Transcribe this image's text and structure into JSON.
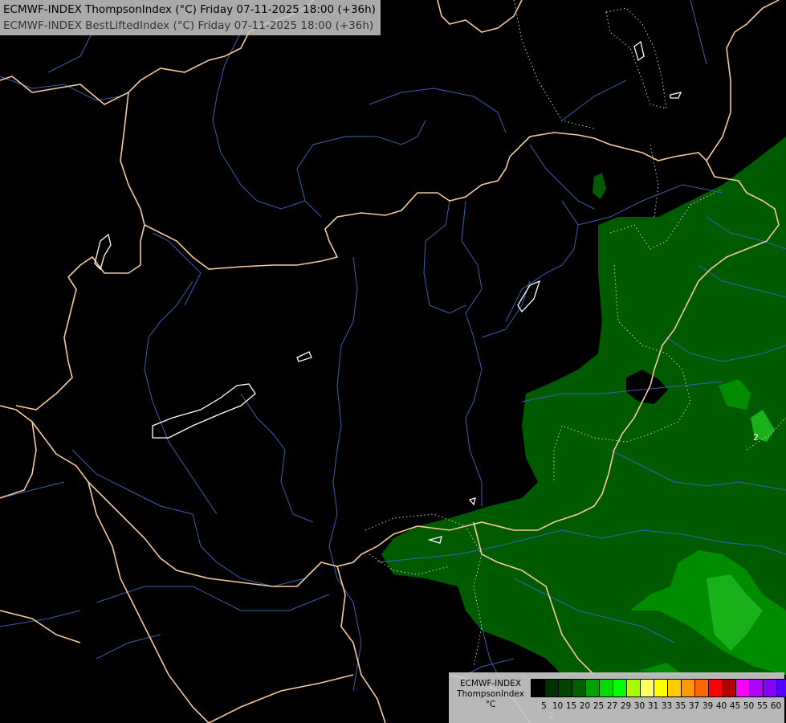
{
  "header": {
    "line1": "ECMWF-INDEX ThompsonIndex (°C) Friday 07-11-2025 18:00 (+36h)",
    "line2": "ECMWF-INDEX BestLiftedIndex (°C) Friday 07-11-2025 18:00 (+36h)"
  },
  "legend": {
    "model": "ECMWF-INDEX",
    "parameter": "ThompsonIndex",
    "unit": "°C",
    "levels": [
      "5",
      "10",
      "15",
      "20",
      "25",
      "27",
      "29",
      "30",
      "31",
      "33",
      "35",
      "37",
      "39",
      "40",
      "45",
      "50",
      "55",
      "60"
    ],
    "colors": [
      "#000000",
      "#003000",
      "#004400",
      "#006000",
      "#00a000",
      "#00dc00",
      "#00ff00",
      "#a8ff00",
      "#ffff66",
      "#ffff00",
      "#ffcc00",
      "#ff9900",
      "#ff6600",
      "#ff0000",
      "#b40000",
      "#ff00ff",
      "#b000ff",
      "#8800ff",
      "#5500ff",
      "#0000ff"
    ]
  },
  "map_labels": {
    "contour_label_east": "2",
    "contour_label_south": "2"
  },
  "colors": {
    "background": "#000000",
    "borders": "#f5c99a",
    "rivers": "#3a5fb0",
    "field_dark": "#005a00",
    "field_mid": "#008c00",
    "field_light": "#19b019",
    "lakes": "#ffffff"
  }
}
